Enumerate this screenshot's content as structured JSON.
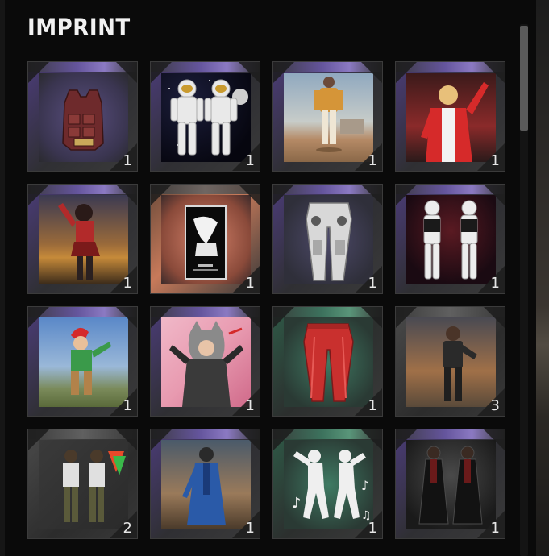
{
  "header": {
    "title": "IMPRINT"
  },
  "items": [
    {
      "name": "vest-icon",
      "rarity": "purple",
      "qty": "1"
    },
    {
      "name": "astronaut-set-icon",
      "rarity": "purple",
      "qty": "1"
    },
    {
      "name": "casual-outfit-icon",
      "rarity": "purple",
      "qty": "1"
    },
    {
      "name": "racer-outfit-icon",
      "rarity": "purple",
      "qty": "1"
    },
    {
      "name": "punk-outfit-icon",
      "rarity": "purple",
      "qty": "1"
    },
    {
      "name": "poster-icon",
      "rarity": "gray",
      "qty": "1"
    },
    {
      "name": "armored-pants-icon",
      "rarity": "purple",
      "qty": "1"
    },
    {
      "name": "bodysuit-pair-icon",
      "rarity": "purple",
      "qty": "1"
    },
    {
      "name": "clown-outfit-icon",
      "rarity": "purple",
      "qty": "1"
    },
    {
      "name": "wolf-costume-icon",
      "rarity": "purple",
      "qty": "1"
    },
    {
      "name": "red-pants-icon",
      "rarity": "green",
      "qty": "1"
    },
    {
      "name": "tactical-outfit-icon",
      "rarity": "gray",
      "qty": "3"
    },
    {
      "name": "collab-set-icon",
      "rarity": "gray",
      "qty": "2"
    },
    {
      "name": "blue-coat-outfit-icon",
      "rarity": "purple",
      "qty": "1"
    },
    {
      "name": "dance-emote-icon",
      "rarity": "green",
      "qty": "1"
    },
    {
      "name": "long-coat-set-icon",
      "rarity": "purple",
      "qty": "1"
    }
  ]
}
